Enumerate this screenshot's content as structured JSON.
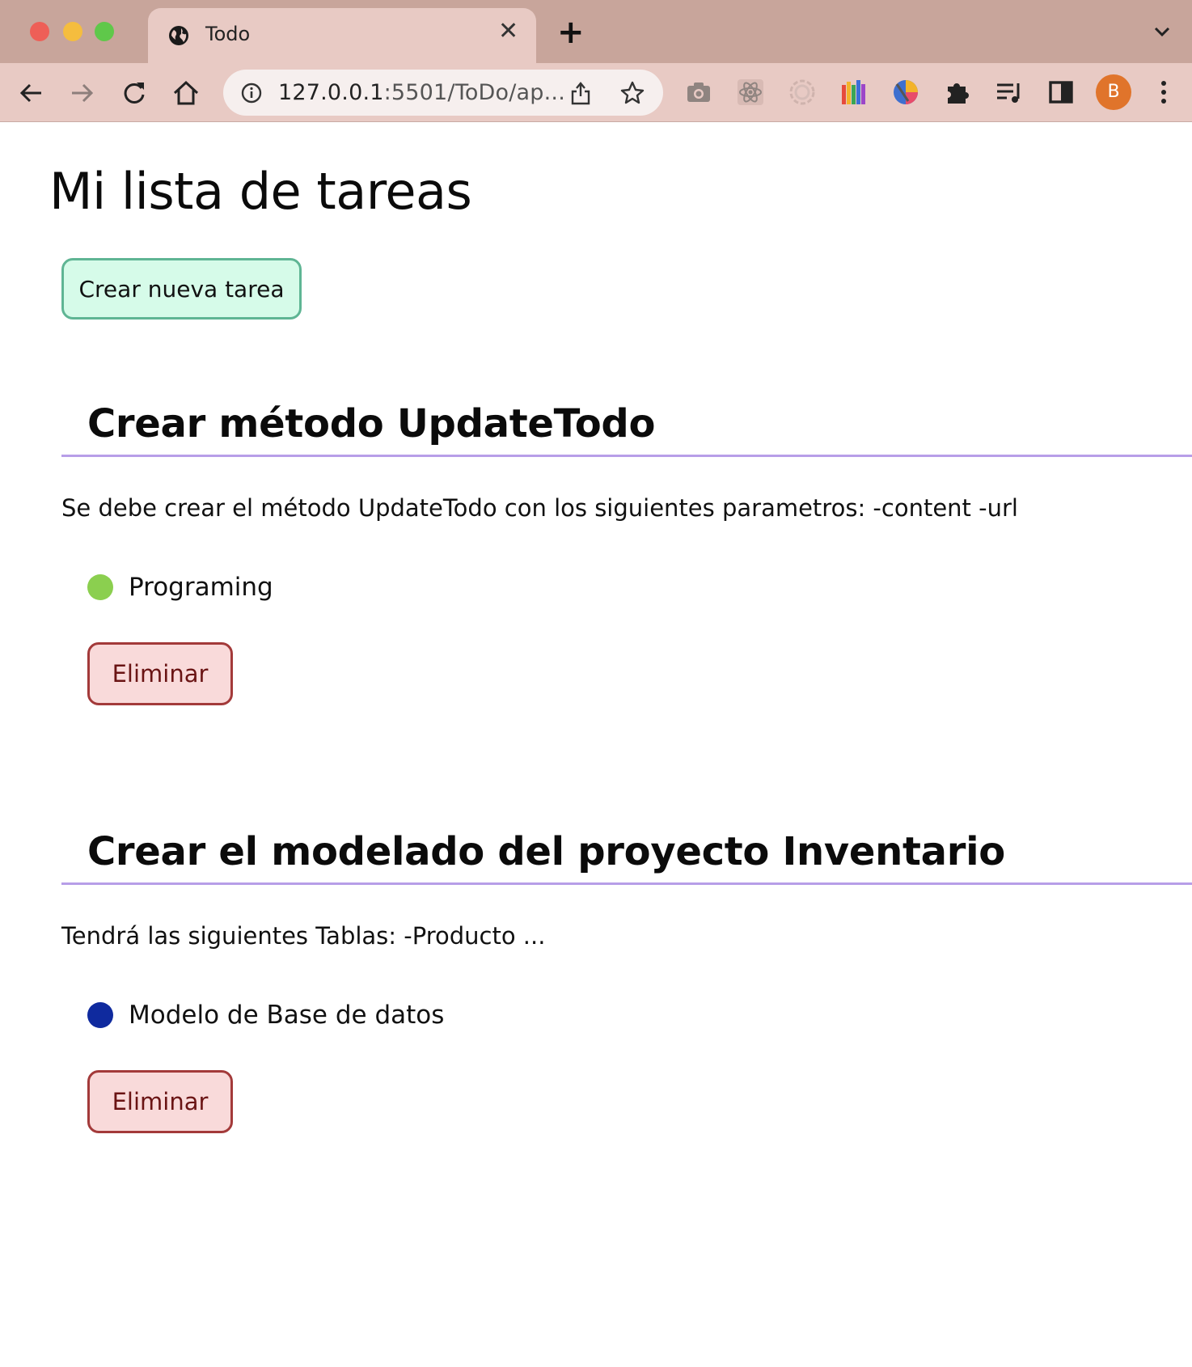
{
  "browser": {
    "tab_title": "Todo",
    "tab_close": "✕",
    "new_tab": "+",
    "url_host": "127.0.0.1",
    "url_rest": ":5501/ToDo/ap...",
    "profile_initial": "B"
  },
  "page": {
    "title": "Mi lista de tareas",
    "create_button_label": "Crear nueva tarea"
  },
  "todos": [
    {
      "title": "Crear método UpdateTodo",
      "description": "Se debe crear el método UpdateTodo con los siguientes parametros: -content -url",
      "tag_label": "Programing",
      "tag_color": "#8bcf4f",
      "delete_label": "Eliminar"
    },
    {
      "title": "Crear el modelado del proyecto Inventario",
      "description": "Tendrá las siguientes Tablas: -Producto ...",
      "tag_label": "Modelo de Base de datos",
      "tag_color": "#0f2a9e",
      "delete_label": "Eliminar"
    }
  ]
}
